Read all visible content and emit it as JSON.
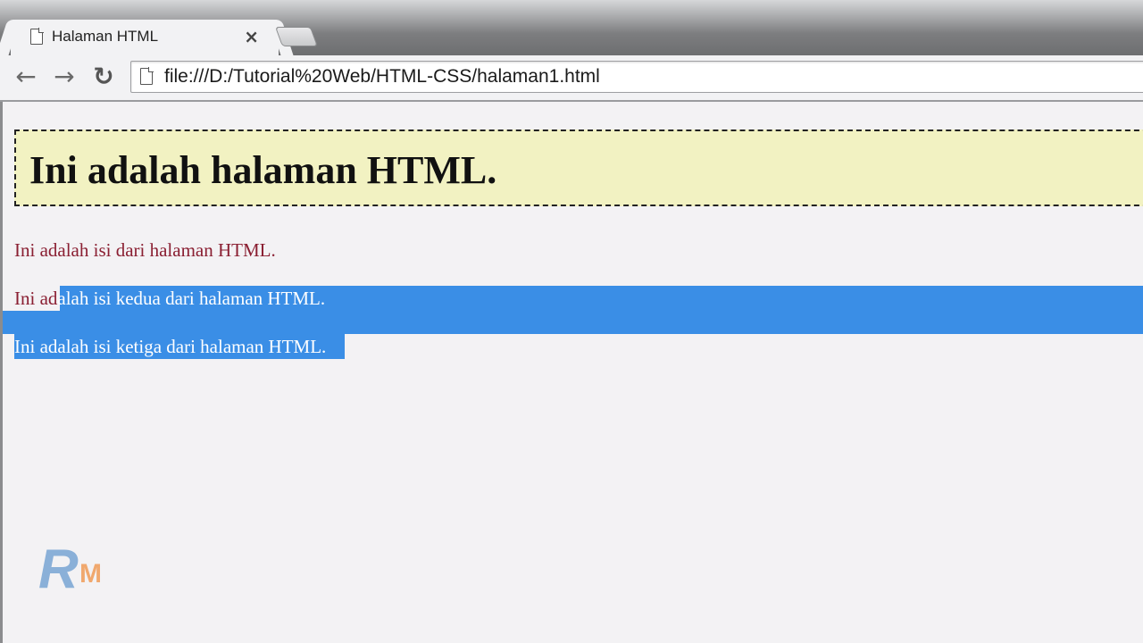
{
  "browser": {
    "tab": {
      "title": "Halaman HTML",
      "close_label": "×"
    },
    "nav": {
      "back_glyph": "←",
      "forward_glyph": "→",
      "reload_glyph": "↻"
    },
    "address_bar": {
      "url": "file:///D:/Tutorial%20Web/HTML-CSS/halaman1.html"
    }
  },
  "page": {
    "heading": "Ini adalah halaman HTML.",
    "paragraph_1": "Ini adalah isi dari halaman HTML.",
    "paragraph_2_unselected": "Ini ad",
    "paragraph_2_selected": "alah isi kedua dari halaman HTML.",
    "paragraph_3": "Ini adalah isi ketiga dari halaman HTML."
  },
  "colors": {
    "heading_background": "#f2f2c2",
    "paragraph_text": "#8a1f32",
    "selection": "#3a8ee6"
  },
  "watermark": {
    "letters": "RM"
  }
}
